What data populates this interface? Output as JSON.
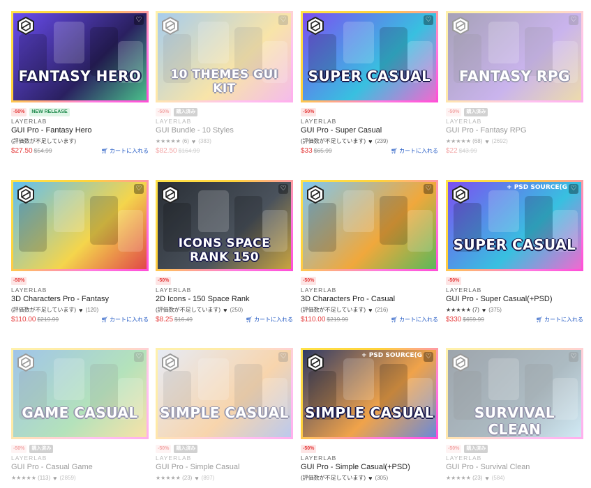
{
  "cards": [
    {
      "title": "GUI Pro - Fantasy Hero",
      "publisher": "LAYERLAB",
      "art_text": "FANTASY HERO",
      "ribbon": "",
      "badges": [
        "-50%",
        "NEW RELEASE"
      ],
      "rating": "(評価数が不足しています)",
      "favorites": "",
      "price": "$27.50",
      "original_price": "$54.99",
      "cart_label": "カートに入れる",
      "faded": false,
      "palette": [
        "#6a4df0",
        "#2a2060",
        "#49c08a"
      ]
    },
    {
      "title": "GUI Bundle - 10 Styles",
      "publisher": "LAYERLAB",
      "art_text": "10 THEMES GUI KIT",
      "ribbon": "",
      "badges": [
        "-50%",
        "購入済み"
      ],
      "rating": "★★★★★ (6)",
      "favorites": "(383)",
      "price": "$82.50",
      "original_price": "$164.99",
      "cart_label": "",
      "faded": true,
      "palette": [
        "#3a8fd8",
        "#f1c541",
        "#e86cd3"
      ]
    },
    {
      "title": "GUI Pro - Super Casual",
      "publisher": "LAYERLAB",
      "art_text": "SUPER CASUAL",
      "ribbon": "",
      "badges": [
        "-50%"
      ],
      "rating": "(評価数が不足しています)",
      "favorites": "(239)",
      "price": "$33",
      "original_price": "$65.99",
      "cart_label": "カートに入れる",
      "faded": false,
      "palette": [
        "#7c4df2",
        "#38c0e0",
        "#f06ad0"
      ]
    },
    {
      "title": "GUI Pro - Fantasy RPG",
      "publisher": "LAYERLAB",
      "art_text": "FANTASY RPG",
      "ribbon": "",
      "badges": [
        "-50%",
        "購入済み"
      ],
      "rating": "★★★★★ (68)",
      "favorites": "(2692)",
      "price": "$22",
      "original_price": "$43.99",
      "cart_label": "",
      "faded": true,
      "palette": [
        "#3b3160",
        "#8a5ad8",
        "#d8b048"
      ]
    },
    {
      "title": "3D Characters Pro - Fantasy",
      "publisher": "LAYERLAB",
      "art_text": "",
      "ribbon": "",
      "badges": [
        "-50%"
      ],
      "rating": "(評価数が不足しています)",
      "favorites": "(120)",
      "price": "$110.00",
      "original_price": "$219.99",
      "cart_label": "カートに入れる",
      "faded": false,
      "palette": [
        "#5fbff2",
        "#f4d54c",
        "#e04848"
      ]
    },
    {
      "title": "2D Icons - 150 Space Rank",
      "publisher": "LAYERLAB",
      "art_text": "ICONS SPACE RANK 150",
      "ribbon": "",
      "badges": [
        "-50%"
      ],
      "rating": "(評価数が不足しています)",
      "favorites": "(250)",
      "price": "$8.25",
      "original_price": "$16.49",
      "cart_label": "カートに入れる",
      "faded": false,
      "palette": [
        "#2a2f36",
        "#4a525c",
        "#c9a440"
      ]
    },
    {
      "title": "3D Characters Pro - Casual",
      "publisher": "LAYERLAB",
      "art_text": "",
      "ribbon": "",
      "badges": [
        "-50%"
      ],
      "rating": "(評価数が不足しています)",
      "favorites": "(216)",
      "price": "$110.00",
      "original_price": "$219.99",
      "cart_label": "カートに入れる",
      "faded": false,
      "palette": [
        "#7fc7f0",
        "#f0a83c",
        "#5bb85a"
      ]
    },
    {
      "title": "GUI Pro - Super Casual(+PSD)",
      "publisher": "LAYERLAB",
      "art_text": "SUPER CASUAL",
      "ribbon": "+ PSD SOURCE(G",
      "badges": [
        "-50%"
      ],
      "rating": "★★★★★ (7)",
      "favorites": "(375)",
      "price": "$330",
      "original_price": "$659.99",
      "cart_label": "カートに入れる",
      "faded": false,
      "palette": [
        "#7c4df2",
        "#38c0e0",
        "#f06ad0"
      ]
    },
    {
      "title": "GUI Pro - Casual Game",
      "publisher": "LAYERLAB",
      "art_text": "GAME CASUAL",
      "ribbon": "",
      "badges": [
        "-50%",
        "購入済み"
      ],
      "rating": "★★★★★ (113)",
      "favorites": "(2859)",
      "price": "",
      "original_price": "",
      "cart_label": "",
      "faded": true,
      "palette": [
        "#2f7fd0",
        "#5ac06a",
        "#f0c040"
      ]
    },
    {
      "title": "GUI Pro - Simple Casual",
      "publisher": "LAYERLAB",
      "art_text": "SIMPLE CASUAL",
      "ribbon": "",
      "badges": [
        "-50%",
        "購入済み"
      ],
      "rating": "★★★★★ (23)",
      "favorites": "(897)",
      "price": "",
      "original_price": "",
      "cart_label": "",
      "faded": true,
      "palette": [
        "#c9d4ea",
        "#f0a34a",
        "#6b8ad8"
      ]
    },
    {
      "title": "GUI Pro - Simple Casual(+PSD)",
      "publisher": "LAYERLAB",
      "art_text": "SIMPLE CASUAL",
      "ribbon": "+ PSD SOURCE(G",
      "badges": [
        "-50%"
      ],
      "rating": "(評価数が不足しています)",
      "favorites": "(305)",
      "price": "",
      "original_price": "",
      "cart_label": "",
      "faded": false,
      "palette": [
        "#2f3a66",
        "#f0a34a",
        "#6b8ad8"
      ]
    },
    {
      "title": "GUI Pro - Survival Clean",
      "publisher": "LAYERLAB",
      "art_text": "SURVIVAL CLEAN",
      "ribbon": "",
      "badges": [
        "-50%",
        "購入済み"
      ],
      "rating": "★★★★★ (23)",
      "favorites": "(584)",
      "price": "",
      "original_price": "",
      "cart_label": "",
      "faded": true,
      "palette": [
        "#2a3a4a",
        "#4a6a7a",
        "#9ad0e8"
      ]
    }
  ]
}
